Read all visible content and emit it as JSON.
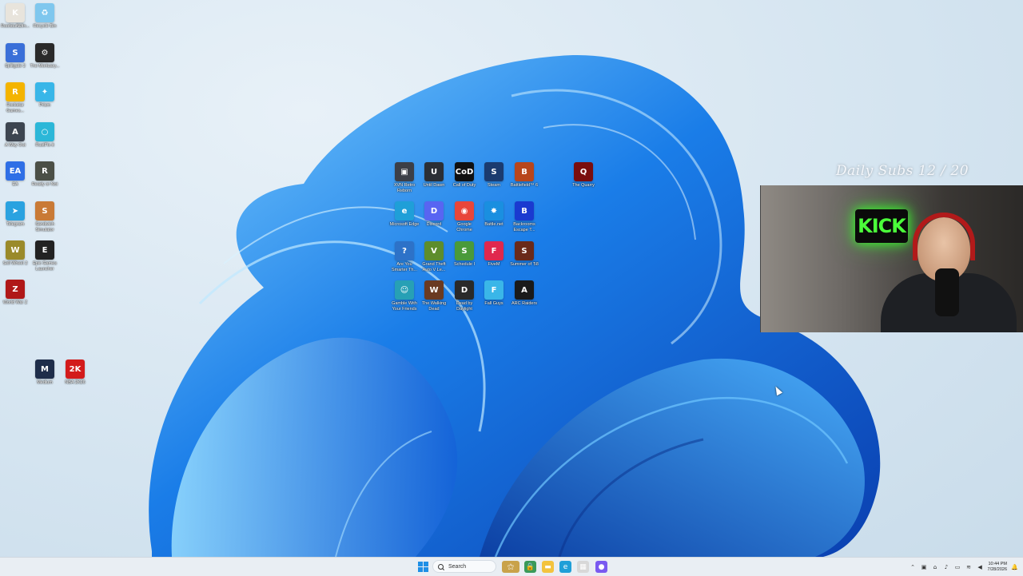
{
  "desktop": {
    "left_icons": [
      {
        "label": "Roofstuff&fin...",
        "icon": "roof-app-icon",
        "color": "#e8e4dc",
        "glyph": "K"
      },
      {
        "label": "Recycle Bin",
        "icon": "recycle-bin-icon",
        "color": "#7fc7ee",
        "glyph": "♻"
      },
      {
        "label": "Splitgate 2",
        "icon": "splitgate-icon",
        "color": "#3a6fd8",
        "glyph": "S"
      },
      {
        "label": "The Mortuary...",
        "icon": "mortuary-game-icon",
        "color": "#2a2a2a",
        "glyph": "⚙"
      },
      {
        "label": "Rockstar Games...",
        "icon": "rockstar-icon",
        "color": "#f4b400",
        "glyph": "R"
      },
      {
        "label": "Prism",
        "icon": "prism-icon",
        "color": "#38b6e8",
        "glyph": "✦"
      },
      {
        "label": "A Way Out",
        "icon": "a-way-out-icon",
        "color": "#3d4550",
        "glyph": "A"
      },
      {
        "label": "RustFix-it",
        "icon": "rustfix-icon",
        "color": "#2cb7d8",
        "glyph": "○"
      },
      {
        "label": "EA",
        "icon": "ea-icon",
        "color": "#2f6fe6",
        "glyph": "EA"
      },
      {
        "label": "Ready or Not",
        "icon": "ready-or-not-icon",
        "color": "#4b4f46",
        "glyph": "R"
      },
      {
        "label": "Telegram",
        "icon": "telegram-icon",
        "color": "#2aa2e0",
        "glyph": "➤"
      },
      {
        "label": "Sandwich Simulator",
        "icon": "sandwich-icon",
        "color": "#c97a36",
        "glyph": "S"
      },
      {
        "label": "Sell Wheel 2",
        "icon": "sell-wheel-icon",
        "color": "#9a8a2a",
        "glyph": "W"
      },
      {
        "label": "Epic Games Launcher",
        "icon": "epic-games-icon",
        "color": "#222222",
        "glyph": "E"
      },
      {
        "label": "World War Z",
        "icon": "world-war-z-icon",
        "color": "#b01818",
        "glyph": "Z"
      },
      {
        "label": "Medium",
        "icon": "medal-icon",
        "color": "#1e2d4a",
        "glyph": "M"
      },
      {
        "label": "NBA 2K26",
        "icon": "nba2k-icon",
        "color": "#d31b1b",
        "glyph": "2K"
      }
    ],
    "center_icons": [
      {
        "label": "XVN Retro Reborn",
        "icon": "retro-icon",
        "color": "#3c3f47",
        "glyph": "▣"
      },
      {
        "label": "Until Dawn",
        "icon": "until-dawn-icon",
        "color": "#2b2f35",
        "glyph": "U"
      },
      {
        "label": "Call of Duty",
        "icon": "call-of-duty-icon",
        "color": "#111111",
        "glyph": "CoD"
      },
      {
        "label": "Steam",
        "icon": "steam-icon",
        "color": "#1b3b6f",
        "glyph": "S"
      },
      {
        "label": "Battlefield™ 6",
        "icon": "battlefield-icon",
        "color": "#b8461c",
        "glyph": "B"
      },
      {
        "label": "The Quarry",
        "icon": "the-quarry-icon",
        "color": "#7a0e0e",
        "glyph": "Q"
      },
      {
        "label": "Microsoft Edge",
        "icon": "edge-icon",
        "color": "#1f9fd8",
        "glyph": "e"
      },
      {
        "label": "Discord",
        "icon": "discord-icon",
        "color": "#5865f2",
        "glyph": "D"
      },
      {
        "label": "Google Chrome",
        "icon": "chrome-icon",
        "color": "#e8463a",
        "glyph": "◉"
      },
      {
        "label": "Battle.net",
        "icon": "battlenet-icon",
        "color": "#1a8fe0",
        "glyph": "✸"
      },
      {
        "label": "Backrooms Escape T...",
        "icon": "backrooms-icon",
        "color": "#1a3ad0",
        "glyph": "B"
      },
      {
        "label": "Are You Smarter Th...",
        "icon": "smarter-icon",
        "color": "#2d72c8",
        "glyph": "?"
      },
      {
        "label": "Grand Theft Auto V Le...",
        "icon": "gta-icon",
        "color": "#5d8d2c",
        "glyph": "V"
      },
      {
        "label": "Schedule I",
        "icon": "schedule-icon",
        "color": "#4a9a3a",
        "glyph": "S"
      },
      {
        "label": "FiveM",
        "icon": "fivem-icon",
        "color": "#e0284e",
        "glyph": "F"
      },
      {
        "label": "Summer of '58",
        "icon": "summer58-icon",
        "color": "#6a2a1a",
        "glyph": "S"
      },
      {
        "label": "Gamble With Your Friends",
        "icon": "gamble-icon",
        "color": "#27a0b5",
        "glyph": "☺"
      },
      {
        "label": "The Walking Dead",
        "icon": "walking-dead-icon",
        "color": "#6a3a22",
        "glyph": "W"
      },
      {
        "label": "Dead by Daylight",
        "icon": "dead-by-daylight-icon",
        "color": "#2a2a2a",
        "glyph": "D"
      },
      {
        "label": "Fall Guys",
        "icon": "fall-guys-icon",
        "color": "#3ab6e8",
        "glyph": "F"
      },
      {
        "label": "ARC Raiders",
        "icon": "arc-raiders-icon",
        "color": "#1a1a1a",
        "glyph": "A"
      }
    ]
  },
  "stream_overlay": {
    "subs_goal": "Daily Subs 12 / 20",
    "kick_sign": "KICK"
  },
  "taskbar": {
    "search_label": "Search",
    "pinned": [
      {
        "icon": "widget-icon",
        "color": "#c9a24a",
        "glyph": "⚝"
      },
      {
        "icon": "store-lock-icon",
        "color": "#3a9a5a",
        "glyph": "🔒"
      },
      {
        "icon": "file-explorer-icon",
        "color": "#f3c33e",
        "glyph": "▬"
      },
      {
        "icon": "edge-taskbar-icon",
        "color": "#1f9fd8",
        "glyph": "e"
      },
      {
        "icon": "calendar-app-icon",
        "color": "#d8d8d8",
        "glyph": "▦"
      },
      {
        "icon": "obs-icon",
        "color": "#7a5af0",
        "glyph": "●"
      }
    ],
    "time": "10:44 PM",
    "date": "7/28/2026"
  }
}
